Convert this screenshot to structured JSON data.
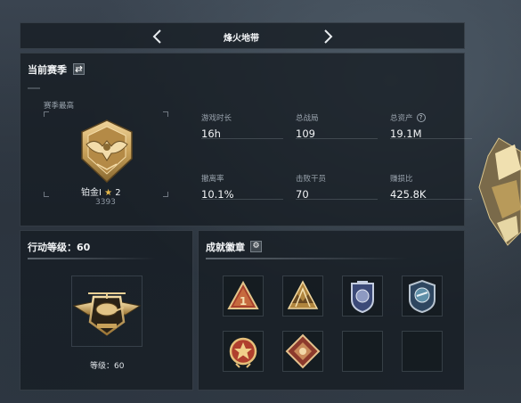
{
  "header": {
    "title": "烽火地带"
  },
  "season": {
    "title": "当前赛季",
    "peak_label": "赛季最高",
    "rank_name": "铂金I",
    "rank_stars": "2",
    "rank_score": "3393",
    "stats": [
      {
        "label": "游戏时长",
        "value": "16h"
      },
      {
        "label": "总战局",
        "value": "109"
      },
      {
        "label": "总资产",
        "value": "19.1M"
      },
      {
        "label": "撤离率",
        "value": "10.1%"
      },
      {
        "label": "击败干员",
        "value": "70"
      },
      {
        "label": "赚损比",
        "value": "425.8K"
      }
    ],
    "help_icon_glyph": "?"
  },
  "action_level": {
    "title": "行动等级：60",
    "level_text": "等级：60"
  },
  "achievements": {
    "title": "成就徽章",
    "badges": [
      {
        "icon": "triangle-number-1-badge-icon"
      },
      {
        "icon": "gold-wings-badge-icon"
      },
      {
        "icon": "shield-emblem-badge-icon"
      },
      {
        "icon": "blue-shield-badge-icon"
      },
      {
        "icon": "gold-star-medal-badge-icon"
      },
      {
        "icon": "diamond-crest-badge-icon"
      },
      {
        "icon": "empty-slot"
      },
      {
        "icon": "empty-slot"
      }
    ]
  },
  "colors": {
    "gold": "#c9a25a",
    "panel_bg": "#161c23",
    "accent_red": "#a8412c"
  }
}
